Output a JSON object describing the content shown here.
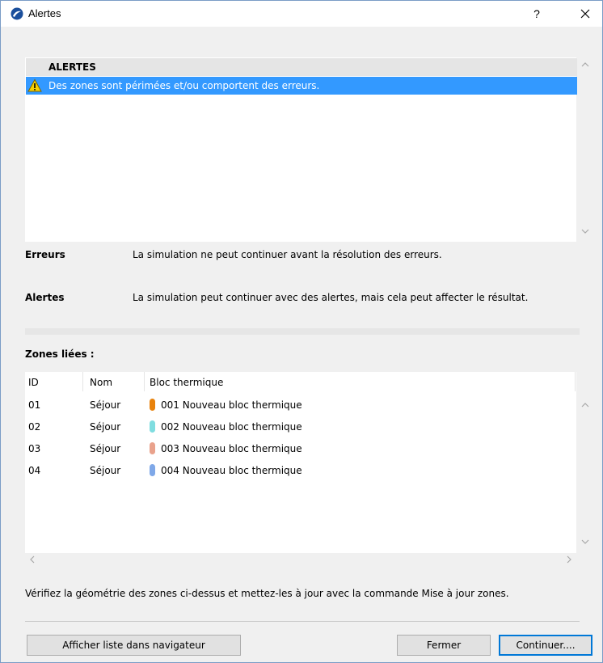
{
  "window": {
    "title": "Alertes",
    "help_label": "?"
  },
  "alerts": {
    "header": "ALERTES",
    "items": [
      {
        "icon": "warning-icon",
        "text": "Des zones sont périmées et/ou comportent des erreurs."
      }
    ]
  },
  "legend": [
    {
      "key": "Erreurs",
      "value": "La simulation ne peut continuer avant la résolution des erreurs."
    },
    {
      "key": "Alertes",
      "value": "La simulation peut continuer avec des alertes, mais cela peut affecter le résultat."
    }
  ],
  "zones": {
    "title": "Zones liées :",
    "columns": [
      "ID",
      "Nom",
      "Bloc thermique"
    ],
    "rows": [
      {
        "id": "01",
        "nom": "Séjour",
        "bloc": "001 Nouveau bloc thermique",
        "color": "#e8820c"
      },
      {
        "id": "02",
        "nom": "Séjour",
        "bloc": "002 Nouveau bloc thermique",
        "color": "#7fdde0"
      },
      {
        "id": "03",
        "nom": "Séjour",
        "bloc": "003 Nouveau bloc thermique",
        "color": "#e9a28c"
      },
      {
        "id": "04",
        "nom": "Séjour",
        "bloc": "004 Nouveau bloc thermique",
        "color": "#7fa8e8"
      }
    ]
  },
  "info": "Vérifiez la géométrie des zones ci-dessus et mettez-les à jour avec la commande Mise à jour zones.",
  "buttons": {
    "show_list": "Afficher liste dans navigateur",
    "close": "Fermer",
    "continue": "Continuer...."
  },
  "colors": {
    "selection": "#3399ff",
    "accent": "#0078d7"
  }
}
